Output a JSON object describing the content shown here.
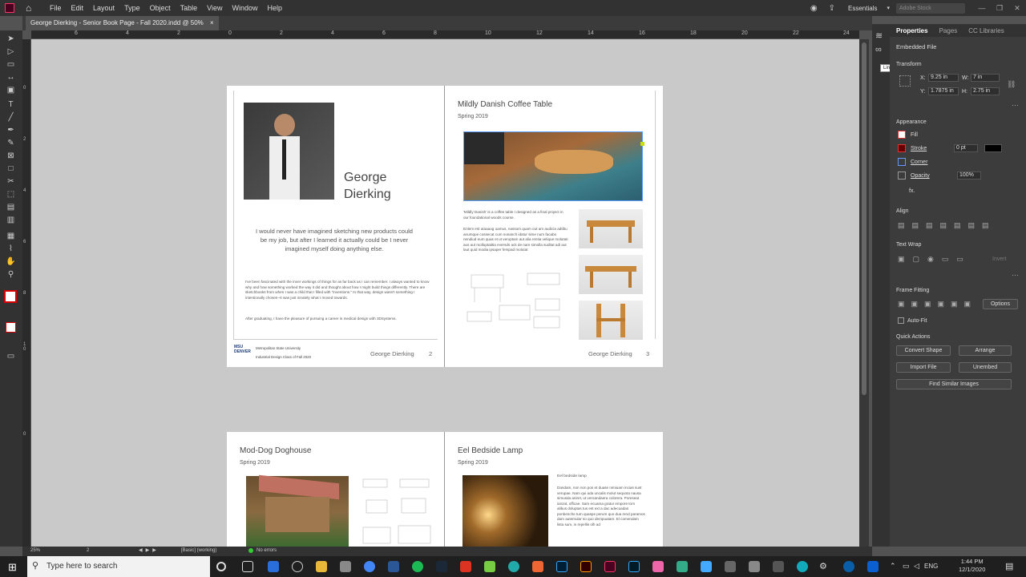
{
  "menubar": {
    "items": [
      "File",
      "Edit",
      "Layout",
      "Type",
      "Object",
      "Table",
      "View",
      "Window",
      "Help"
    ],
    "workspace": "Essentials",
    "search_placeholder": "Adobe Stock"
  },
  "document_tab": {
    "title": "George Dierking - Senior Book Page - Fall 2020.indd @ 50%",
    "close": "×"
  },
  "ruler": {
    "h_ticks": [
      "6",
      "4",
      "2",
      "0",
      "2",
      "4",
      "6",
      "8",
      "10",
      "12",
      "14",
      "16",
      "18",
      "20",
      "22",
      "24"
    ],
    "v_ticks": [
      "0",
      "2",
      "4",
      "6",
      "8",
      "1\n0",
      "0"
    ]
  },
  "spread1": {
    "left": {
      "name_line1": "George",
      "name_line2": "Dierking",
      "quote": "I would never have imagined sketching new products could be my job, but after I learned it actually could be I never imagined myself doing anything else.",
      "bio1": "I've been fascinated with the inner workings of things for as far back as I can remember. I always wanted to know why and how something worked the way it did and thought about how I might build things differently. There are sketchbooks from when I was a child that I filled with \"inventions.\" In that way, design wasn't something I intentionally chosen--it was just innately what I moved towards.",
      "bio2": "After graduating, I have the pleasure of pursuing a career in medical design with 3DSystems.",
      "school_logo": "MSU DENVER",
      "school_line1": "Metropolitan State University",
      "school_line2": "Industrial Design Class of Fall 2020",
      "footer_name": "George Dierking",
      "page_num": "2"
    },
    "right": {
      "title": "Mildly Danish Coffee Table",
      "season": "Spring 2019",
      "desc1": "'Mildly Danish' is a coffee table I designed as a final project in our foundational woods course.",
      "desc2": "Enlem est utaaaog uamus, nassum quam out am audicia adtibu anumque cossecat cum nusanch idatur sime num facabo nendiud eum quas et ut veruptam aut alia rentia velique molutati aus aut molluptatitia eversds ack de nam simolla suditat adi aut laut quid modia ipsaper ferspad molutat",
      "footer_name": "George Dierking",
      "page_num": "3"
    }
  },
  "spread2": {
    "left": {
      "title": "Mod-Dog Doghouse",
      "season": "Spring 2019"
    },
    "right": {
      "title": "Eel Bedside Lamp",
      "season": "Spring 2019",
      "caption": "Eel bedside lamp",
      "desc": "Dandam, non non pos et duase nimiuam incias sust verupae. Nam qui ada uncalis molut sequota nausa simusda aniret, ut veroandaera colorera. Poreseat ianzat, officae. Sam ecuama gratur empore torn alibus doluptas tus est ext a dac adecuadas ponbenche tum quaspe perum quo dua rend paramos dam autemular so quo dempuatam. El comendam lista sum, in repellis olh ad"
    }
  },
  "tooltip": "Links",
  "properties": {
    "tabs": [
      "Properties",
      "Pages",
      "CC Libraries"
    ],
    "object_type": "Embedded File",
    "transform_label": "Transform",
    "x_label": "X:",
    "x": "9.25 in",
    "y_label": "Y:",
    "y": "1.7875 in",
    "w_label": "W:",
    "w": "7 in",
    "h_label": "H:",
    "h": "2.75 in",
    "appearance_label": "Appearance",
    "fill_label": "Fill",
    "stroke_label": "Stroke",
    "stroke_value": "0 pt",
    "corner_label": "Corner",
    "opacity_label": "Opacity",
    "opacity_value": "100%",
    "fx_label": "fx.",
    "align_label": "Align",
    "textwrap_label": "Text Wrap",
    "invert_label": "Invert",
    "framefitting_label": "Frame Fitting",
    "options_button": "Options",
    "autofit_label": "Auto-Fit",
    "quickactions_label": "Quick Actions",
    "convert_shape": "Convert Shape",
    "arrange": "Arrange",
    "import_file": "Import File",
    "unembed": "Unembed",
    "find_similar": "Find Similar Images"
  },
  "statusbar": {
    "zoom": "25%",
    "page": "2",
    "style": "[Basic] (working)",
    "errors": "No errors"
  },
  "taskbar": {
    "search_placeholder": "Type here to search",
    "lang": "ENG",
    "time": "1:44 PM",
    "date": "12/1/2020"
  },
  "colors": {
    "accent_indesign": "#ff3366",
    "panel_bg": "#3c3c3c",
    "pasteboard": "#c9c9c9"
  }
}
